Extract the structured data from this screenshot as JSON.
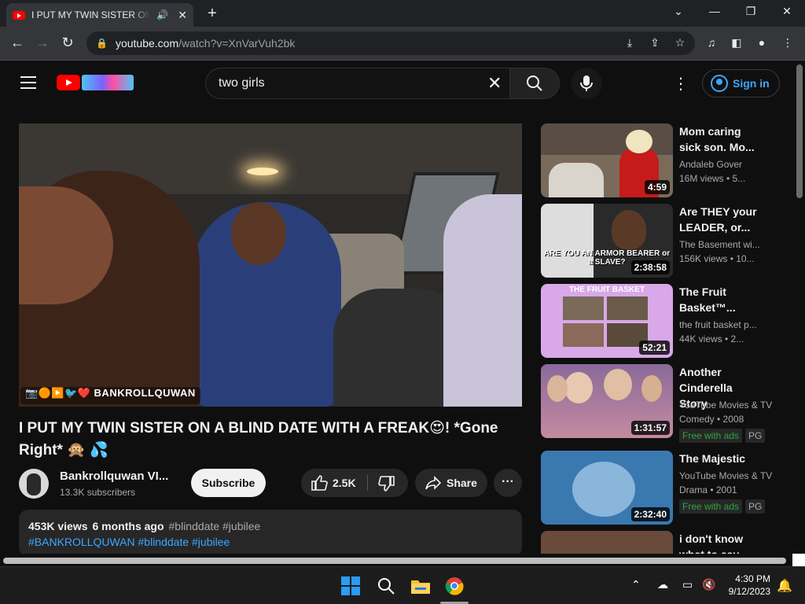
{
  "browser": {
    "tab_title": "I PUT MY TWIN SISTER ON A BLIND DATE WITH A FREAK",
    "new_tab_symbol": "+",
    "url_host": "youtube.com",
    "url_path": "/watch?v=XnVarVuh2bk"
  },
  "header": {
    "search_query": "two girls",
    "sign_in_label": "Sign in"
  },
  "video": {
    "watermark": "📷🟠▶️🐦❤️ BANKROLLQUWAN",
    "title": "I PUT MY TWIN SISTER ON A BLIND DATE WITH A FREAK😍! *Gone Right* 🙊 💦",
    "channel_name": "Bankrollquwan VI...",
    "subscribers": "13.3K subscribers",
    "subscribe_label": "Subscribe",
    "like_count": "2.5K",
    "share_label": "Share",
    "views": "453K views",
    "age": "6 months ago",
    "tags_line1": "#blinddate #jubilee",
    "tags_line2": "#BANKROLLQUWAN #blinddate #jubilee"
  },
  "recommendations": [
    {
      "title_l1": "Mom caring",
      "title_l2": "sick son. Mo...",
      "channel": "Andaleb Gover",
      "meta": "16M views  •  5...",
      "duration": "4:59",
      "thumb_color": "#7a6a5a"
    },
    {
      "title_l1": "Are THEY your",
      "title_l2": "LEADER, or...",
      "channel": "The Basement wi...",
      "meta": "156K views  •  10...",
      "duration": "2:38:58",
      "thumb_color": "#3c3c3c",
      "thumb_text": "ARE YOU AN ARMOR BEARER or a SLAVE?"
    },
    {
      "title_l1": "The Fruit",
      "title_l2": "Basket™...",
      "channel": "the fruit basket p...",
      "meta": "44K views  •  2...",
      "duration": "52:21",
      "thumb_color": "#d8a8e8",
      "thumb_text": "THE FRUIT BASKET"
    },
    {
      "title_l1": "Another Cinderella",
      "title_l2": "Story",
      "channel": "YouTube Movies & TV",
      "meta": "Comedy • 2008",
      "duration": "1:31:57",
      "thumb_color": "#a06a8a",
      "badge_free": "Free with ads",
      "badge_pg": "PG"
    },
    {
      "title_l1": "The Majestic",
      "title_l2": "",
      "channel": "YouTube Movies & TV",
      "meta": "Drama • 2001",
      "duration": "2:32:40",
      "thumb_color": "#3a78b0",
      "badge_free": "Free with ads",
      "badge_pg": "PG"
    },
    {
      "title_l1": "i don't know",
      "title_l2": "what to say",
      "thumb_color": "#6a4a3a"
    }
  ],
  "taskbar": {
    "time": "4:30 PM",
    "date": "9/12/2023"
  }
}
